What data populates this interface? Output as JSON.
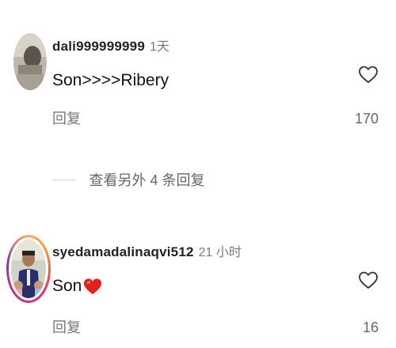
{
  "comments": [
    {
      "username": "dali999999999",
      "time": "1天",
      "text": "Son>>>>Ribery",
      "reply_label": "回复",
      "likes": "170",
      "like_icon": "heart-outline-icon",
      "avatar": "user-avatar-photo"
    },
    {
      "username": "syedamadalinaqvi512",
      "time": "21 小时",
      "text": "Son",
      "emoji": "red-heart-emoji",
      "reply_label": "回复",
      "likes": "16",
      "like_icon": "heart-outline-icon",
      "avatar": "user-avatar-photo-story-ring"
    }
  ],
  "view_replies": {
    "label": "查看另外 4 条回复"
  },
  "colors": {
    "emoji_heart": "#e0221b",
    "story_ring_start": "#fcaf45",
    "story_ring_end": "#833ab4"
  }
}
